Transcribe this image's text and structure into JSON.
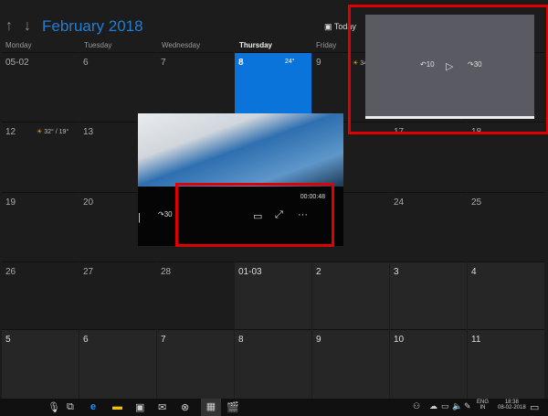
{
  "header": {
    "title": "February 2018",
    "up": "↑",
    "down": "↓",
    "today_label": "Today"
  },
  "days": [
    "Monday",
    "Tuesday",
    "Wednesday",
    "Thursday",
    "Friday"
  ],
  "weeks": [
    [
      "05-02",
      "6",
      "7",
      "8",
      "9",
      "",
      ""
    ],
    [
      "12",
      "13",
      "",
      "",
      "",
      "17",
      "18"
    ],
    [
      "19",
      "20",
      "",
      "",
      "",
      "24",
      "25"
    ],
    [
      "26",
      "27",
      "28",
      "01-03",
      "2",
      "3",
      "4"
    ],
    [
      "5",
      "6",
      "7",
      "8",
      "9",
      "10",
      "11"
    ]
  ],
  "weather": {
    "thu": "24°",
    "fri": "34°",
    "mon12": "32° / 19°"
  },
  "video": {
    "time": "00:00:48",
    "skip_fwd": "30",
    "pip": "▭",
    "fullscreen": "⤢",
    "more": "···"
  },
  "pip": {
    "back": "10",
    "play": "▷",
    "fwd": "30"
  },
  "taskbar": {
    "lang": "ENG",
    "region": "IN",
    "time": "18:38",
    "date": "08-02-2018"
  },
  "colors": {
    "accent": "#0a74da",
    "highlight": "#e00000"
  }
}
